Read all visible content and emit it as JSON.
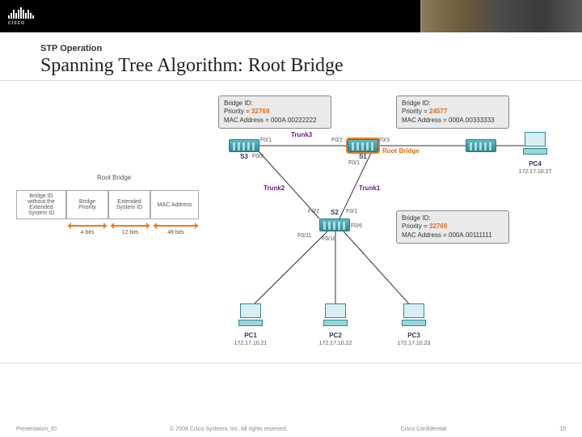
{
  "header": {
    "brand": "cisco"
  },
  "title_block": {
    "eyebrow": "STP Operation",
    "title": "Spanning Tree Algorithm: Root Bridge"
  },
  "bid_boxes": {
    "s3": {
      "l1": "Bridge ID:",
      "l2p": "Priority = ",
      "l2v": "32769",
      "l3": "MAC Address = 000A.00222222"
    },
    "s1": {
      "l1": "Bridge ID:",
      "l2p": "Priority = ",
      "l2v": "24577",
      "l3": "MAC Address = 000A.00333333"
    },
    "s2": {
      "l1": "Bridge ID:",
      "l2p": "Priority = ",
      "l2v": "32769",
      "l3": "MAC Address = 000A.00111111"
    }
  },
  "switches": {
    "s1": "S1",
    "s2": "S2",
    "s3": "S3"
  },
  "root_bridge_label": "Root Bridge",
  "pcs": {
    "pc1": {
      "name": "PC1",
      "ip": "172.17.10.21"
    },
    "pc2": {
      "name": "PC2",
      "ip": "172.17.10.22"
    },
    "pc3": {
      "name": "PC3",
      "ip": "172.17.10.23"
    },
    "pc4": {
      "name": "PC4",
      "ip": "172.17.10.27"
    }
  },
  "ports": {
    "s3_f01": "F0/1",
    "s3_f02": "F0/2",
    "s1_f01": "F0/1",
    "s1_f02": "F0/2",
    "s1_f03": "F0/3",
    "s2_f01": "F0/1",
    "s2_f02": "F0/2",
    "s2_f06": "F0/6",
    "s2_f011": "F0/11",
    "s2_f018": "F0/18"
  },
  "trunks": {
    "t1": "Trunk1",
    "t2": "Trunk2",
    "t3": "Trunk3"
  },
  "bid_table": {
    "title": "Root Bridge",
    "c0": "Bridge ID without the Extended System ID",
    "c1": "Bridge Priority",
    "c2": "Extended System ID",
    "c3": "MAC Address",
    "b1": "4 bits",
    "b2": "12 bits",
    "b3": "48 bits"
  },
  "footer": {
    "left": "Presentation_ID",
    "mid": "© 2008 Cisco Systems, Inc. All rights reserved.",
    "right": "Cisco Confidential",
    "page": "15"
  }
}
